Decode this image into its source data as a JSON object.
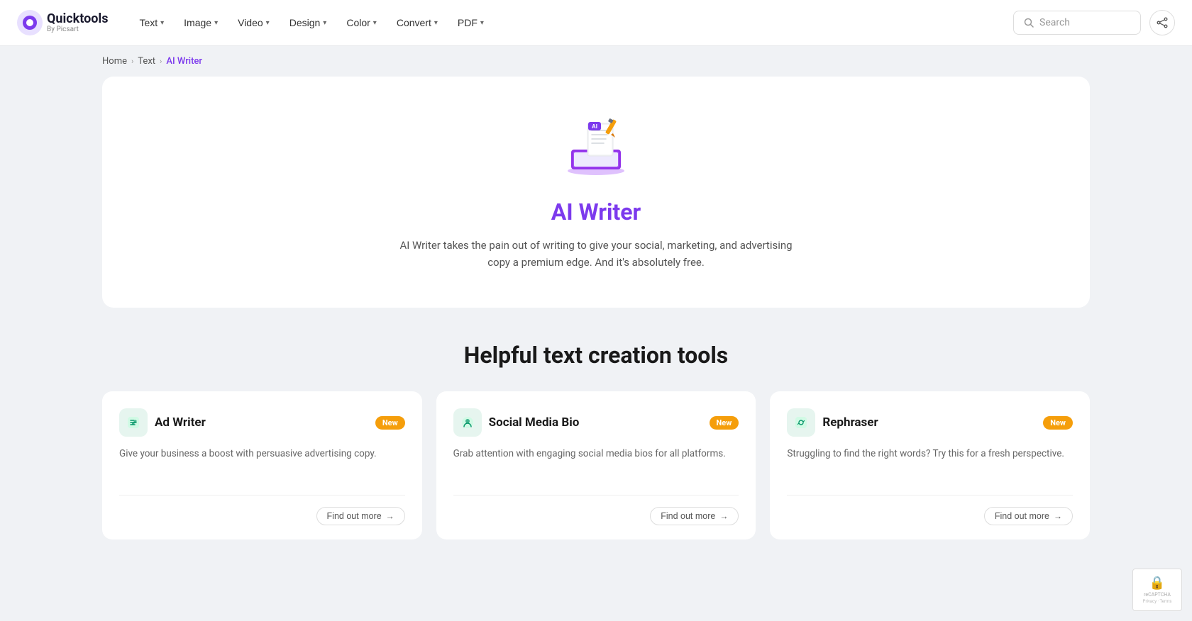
{
  "brand": {
    "name": "Quicktools",
    "sub": "By Picsart",
    "logo_emoji": "🔵"
  },
  "nav": {
    "items": [
      {
        "label": "Text",
        "id": "text"
      },
      {
        "label": "Image",
        "id": "image"
      },
      {
        "label": "Video",
        "id": "video"
      },
      {
        "label": "Design",
        "id": "design"
      },
      {
        "label": "Color",
        "id": "color"
      },
      {
        "label": "Convert",
        "id": "convert"
      },
      {
        "label": "PDF",
        "id": "pdf"
      }
    ]
  },
  "search": {
    "placeholder": "Search"
  },
  "breadcrumb": {
    "home": "Home",
    "text": "Text",
    "current": "AI Writer"
  },
  "hero": {
    "title": "AI Writer",
    "description": "AI Writer takes the pain out of writing to give your social, marketing, and advertising copy a premium edge. And it's absolutely free."
  },
  "section": {
    "title": "Helpful text creation tools"
  },
  "tools": [
    {
      "id": "ad-writer",
      "name": "Ad Writer",
      "description": "Give your business a boost with persuasive advertising copy.",
      "badge": "New",
      "icon": "✏️",
      "icon_bg": "#e6f5ef",
      "find_out": "Find out more"
    },
    {
      "id": "social-media-bio",
      "name": "Social Media Bio",
      "description": "Grab attention with engaging social media bios for all platforms.",
      "badge": "New",
      "icon": "😊",
      "icon_bg": "#e6f5ef",
      "find_out": "Find out more"
    },
    {
      "id": "rephraser",
      "name": "Rephraser",
      "description": "Struggling to find the right words? Try this for a fresh perspective.",
      "badge": "New",
      "icon": "🔄",
      "icon_bg": "#e6f5ef",
      "find_out": "Find out more"
    }
  ],
  "colors": {
    "accent": "#7c3aed",
    "badge": "#f59e0b",
    "icon_bg": "#e6f5ef"
  }
}
